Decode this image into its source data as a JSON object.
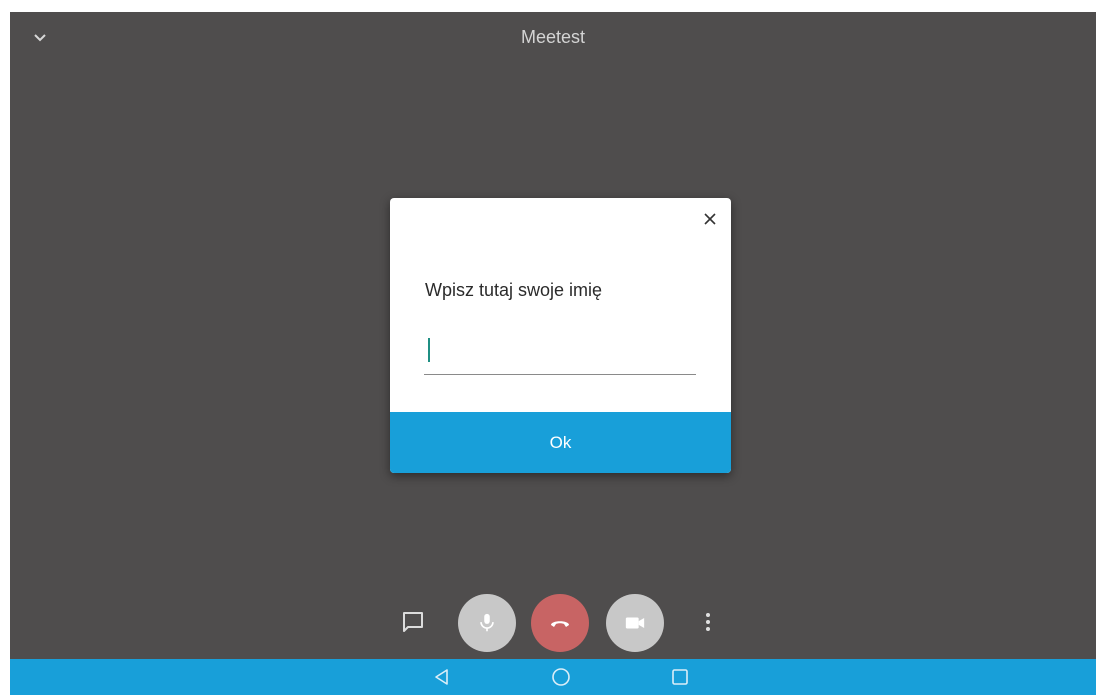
{
  "app": {
    "title": "Meetest"
  },
  "dialog": {
    "prompt": "Wpisz tutaj swoje imię",
    "input_value": "",
    "ok_label": "Ok"
  },
  "icons": {
    "collapse": "chevron-down-icon",
    "close": "close-icon",
    "chat": "chat-icon",
    "mic": "microphone-icon",
    "hangup": "phone-hangup-icon",
    "camera": "video-camera-icon",
    "more": "more-vertical-icon",
    "nav_back": "back-triangle-icon",
    "nav_home": "home-circle-icon",
    "nav_recents": "recents-square-icon"
  },
  "colors": {
    "background": "#4f4d4d",
    "accent": "#189fd9",
    "hangup": "#c86464",
    "control_bg": "#c8c8c8",
    "caret": "#1f8f83"
  }
}
